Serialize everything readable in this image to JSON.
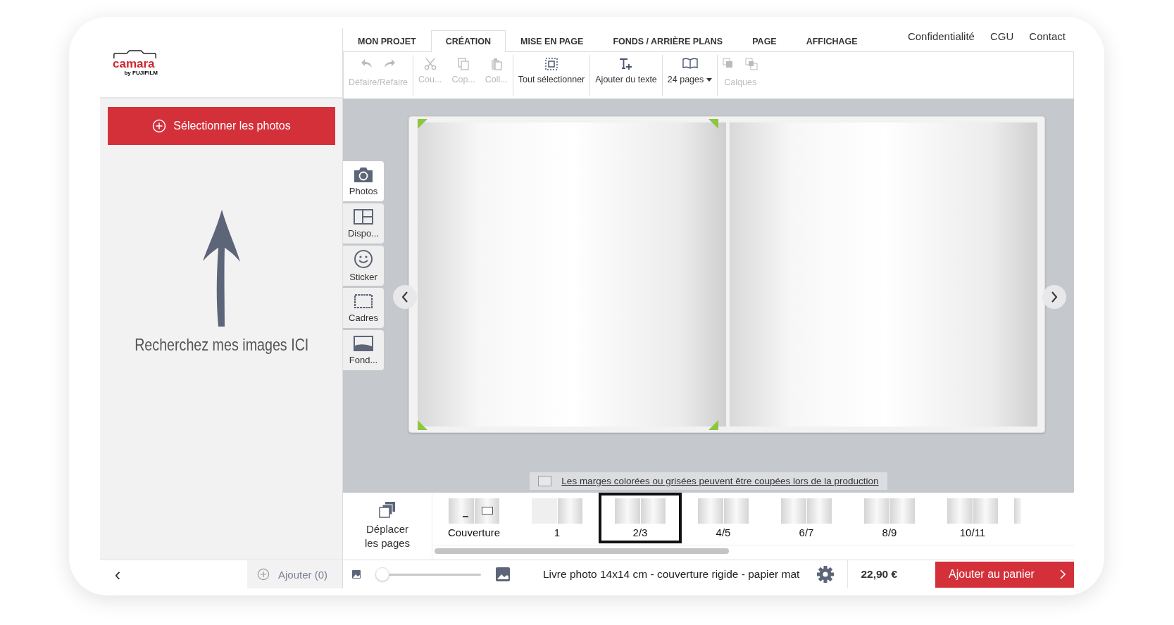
{
  "logo": {
    "name": "camara",
    "byline": "by FUJIFILM"
  },
  "tabs": [
    {
      "label": "MON PROJET",
      "selected": false
    },
    {
      "label": "CRÉATION",
      "selected": true
    },
    {
      "label": "MISE EN PAGE",
      "selected": false
    },
    {
      "label": "FONDS / ARRIÈRE PLANS",
      "selected": false
    },
    {
      "label": "PAGE",
      "selected": false
    },
    {
      "label": "AFFICHAGE",
      "selected": false
    }
  ],
  "header_links": [
    "Confidentialité",
    "CGU",
    "Contact"
  ],
  "toolbar": [
    {
      "kind": "undo-redo",
      "label": "Défaire/Refaire",
      "disabled": true,
      "separator": true
    },
    {
      "kind": "cut",
      "label": "Cou...",
      "disabled": true,
      "separator": false
    },
    {
      "kind": "copy",
      "label": "Cop...",
      "disabled": true,
      "separator": false
    },
    {
      "kind": "paste",
      "label": "Coll...",
      "disabled": true,
      "separator": true
    },
    {
      "kind": "select-all",
      "label": "Tout sélectionner",
      "disabled": false,
      "separator": true
    },
    {
      "kind": "add-text",
      "label": "Ajouter du texte",
      "disabled": false,
      "separator": true
    },
    {
      "kind": "pages",
      "label": "24 pages",
      "disabled": false,
      "separator": true,
      "dropdown": true
    },
    {
      "kind": "layers",
      "label": "Calques",
      "disabled": true,
      "separator": false
    }
  ],
  "left_panel": {
    "select_button": "Sélectionner les photos",
    "hint": "Recherchez mes images ICI",
    "back": "‹",
    "add_button": "Ajouter (0)"
  },
  "side_tabs": [
    {
      "kind": "photos",
      "label": "Photos",
      "selected": true
    },
    {
      "kind": "layout",
      "label": "Dispo...",
      "selected": false
    },
    {
      "kind": "sticker",
      "label": "Sticker",
      "selected": false
    },
    {
      "kind": "frames",
      "label": "Cadres",
      "selected": false
    },
    {
      "kind": "background",
      "label": "Fond...",
      "selected": false
    }
  ],
  "margin_notice": {
    "checked": false,
    "text": "Les marges colorées ou grisées peuvent être coupées lors de la production"
  },
  "filmstrip": {
    "move_button": "Déplacer les pages",
    "thumbnails": [
      {
        "kind": "cover",
        "label": "Couverture",
        "selected": false
      },
      {
        "kind": "single",
        "label": "1",
        "selected": false
      },
      {
        "kind": "spread",
        "label": "2/3",
        "selected": true
      },
      {
        "kind": "spread",
        "label": "4/5",
        "selected": false
      },
      {
        "kind": "spread",
        "label": "6/7",
        "selected": false
      },
      {
        "kind": "spread",
        "label": "8/9",
        "selected": false
      },
      {
        "kind": "spread",
        "label": "10/11",
        "selected": false
      }
    ]
  },
  "zoom": {
    "level": 0
  },
  "product": "Livre photo 14x14 cm - couverture rigide - papier mat",
  "price": "22,90 €",
  "cart_button": "Ajouter au panier"
}
